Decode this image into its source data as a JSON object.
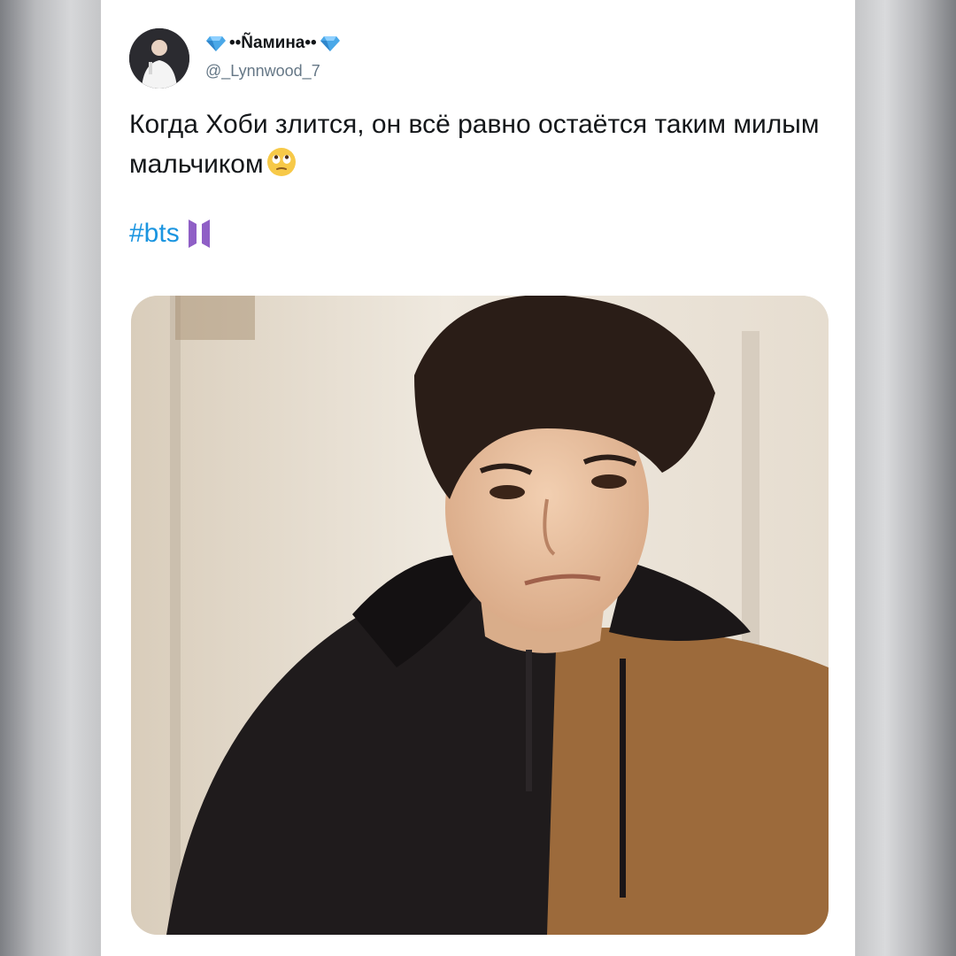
{
  "tweet": {
    "author": {
      "display_name": "••Ñамина••",
      "handle": "@_Lynnwood_7",
      "avatar_icon": "user-avatar",
      "name_decoration_icon": "gem-icon"
    },
    "text": "Когда Хоби злится, он всё равно остаётся таким милым мальчиком",
    "text_emoji_icon": "face-with-rolling-eyes-icon",
    "hashtag": "#bts",
    "hashtag_logo_icon": "bts-logo-icon",
    "media": {
      "type": "video-frame",
      "icon": "video-thumbnail"
    }
  },
  "colors": {
    "link": "#1b95e0",
    "text": "#14171a",
    "secondary_text": "#657786",
    "bts_logo": "#8f5fc6",
    "gem": "#4aa8e8"
  }
}
